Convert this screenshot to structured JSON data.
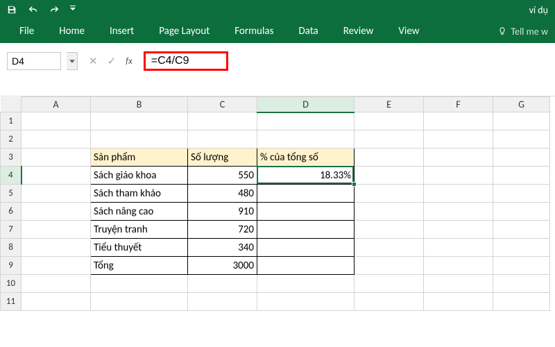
{
  "titlebar": {
    "filename": "ví dụ"
  },
  "ribbon": {
    "file": "File",
    "home": "Home",
    "insert": "Insert",
    "page_layout": "Page Layout",
    "formulas": "Formulas",
    "data": "Data",
    "review": "Review",
    "view": "View",
    "tell_me": "Tell me w"
  },
  "formula_bar": {
    "name_box": "D4",
    "formula": "=C4/C9"
  },
  "columns": [
    "A",
    "B",
    "C",
    "D",
    "E",
    "F",
    "G"
  ],
  "rows": [
    "1",
    "2",
    "3",
    "4",
    "5",
    "6",
    "7",
    "8",
    "9",
    "10",
    "11"
  ],
  "table": {
    "header": {
      "product": "Sản phẩm",
      "qty": "Số lượng",
      "pct": "% của tổng số"
    },
    "rows": [
      {
        "product": "Sách giáo khoa",
        "qty": "550",
        "pct": "18.33%"
      },
      {
        "product": "Sách tham khảo",
        "qty": "480",
        "pct": ""
      },
      {
        "product": "Sách nâng cao",
        "qty": "910",
        "pct": ""
      },
      {
        "product": "Truyện tranh",
        "qty": "720",
        "pct": ""
      },
      {
        "product": "Tiểu thuyết",
        "qty": "340",
        "pct": ""
      },
      {
        "product": "Tổng",
        "qty": "3000",
        "pct": ""
      }
    ]
  },
  "selection": {
    "cell": "D4"
  }
}
